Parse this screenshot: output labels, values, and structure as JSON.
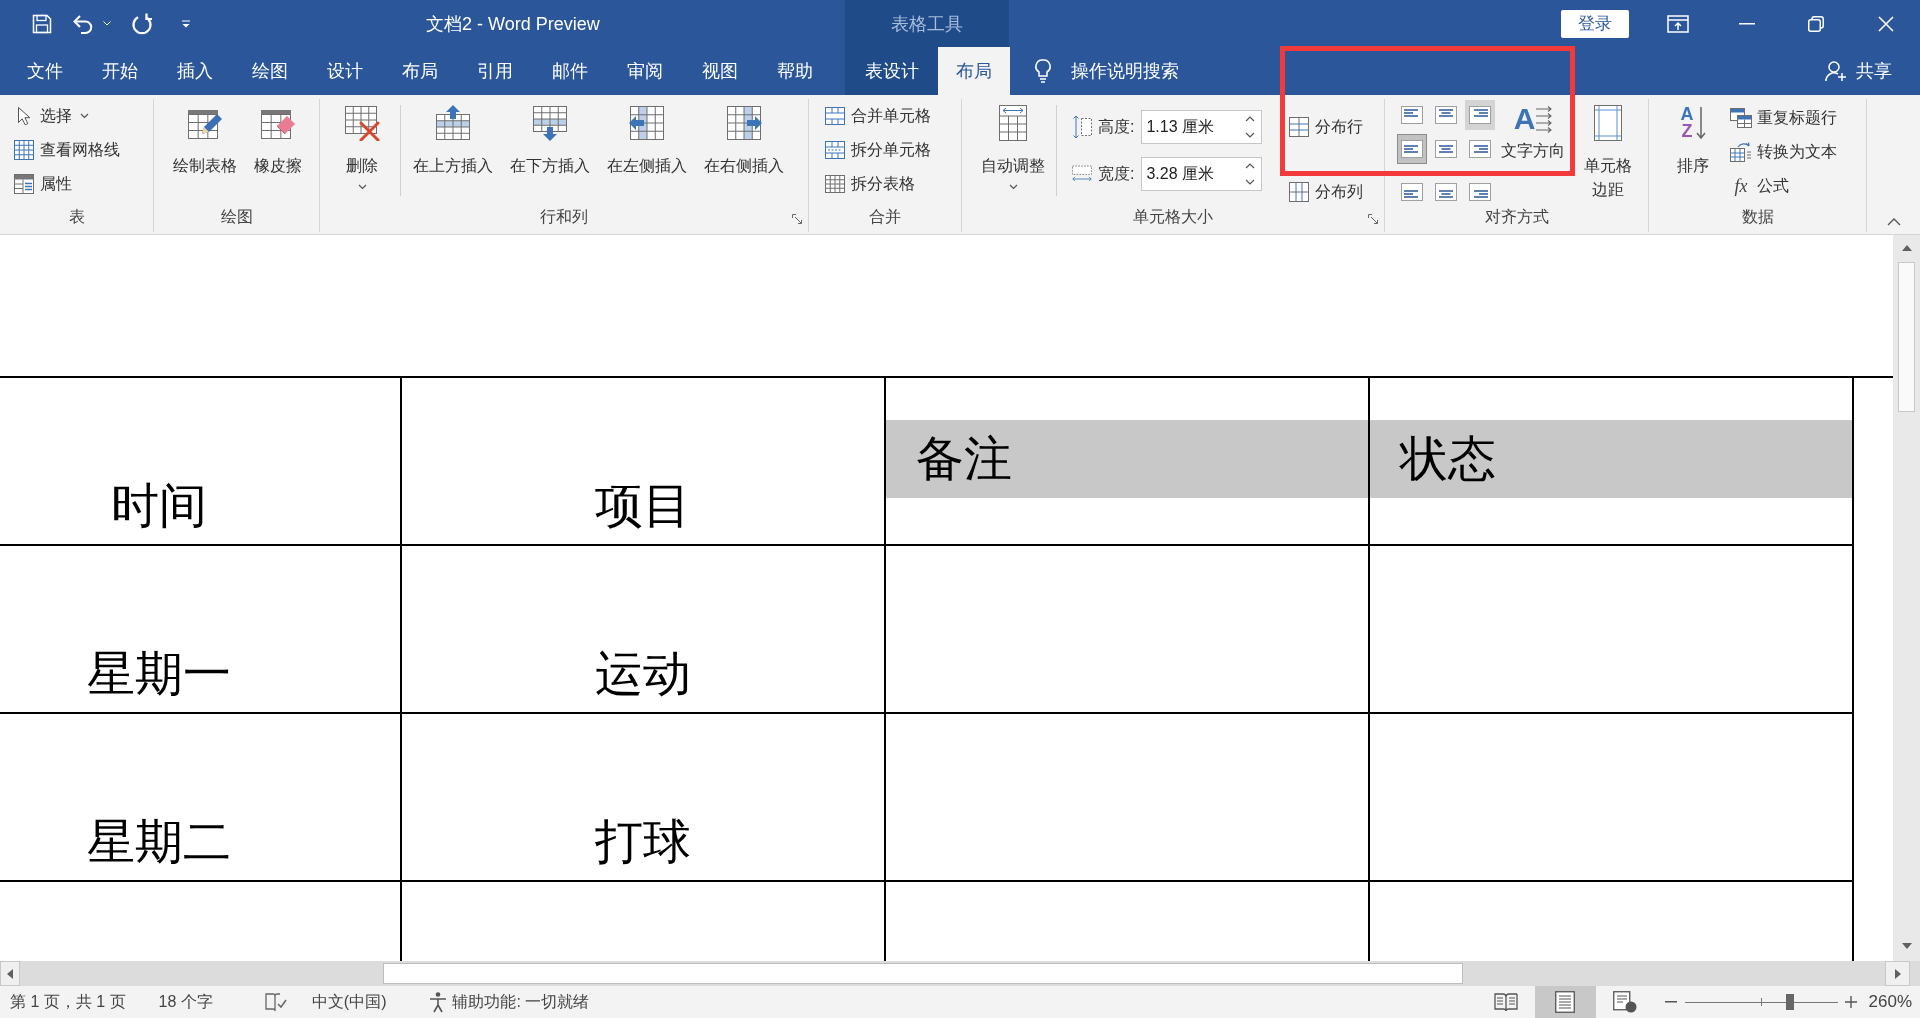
{
  "title_bar": {
    "title": "文档2 - Word Preview",
    "login_button": "登录"
  },
  "tabs": [
    {
      "label": "文件",
      "selected": false
    },
    {
      "label": "开始",
      "selected": false
    },
    {
      "label": "插入",
      "selected": false
    },
    {
      "label": "绘图",
      "selected": false
    },
    {
      "label": "设计",
      "selected": false
    },
    {
      "label": "布局",
      "selected": false
    },
    {
      "label": "引用",
      "selected": false
    },
    {
      "label": "邮件",
      "selected": false
    },
    {
      "label": "审阅",
      "selected": false
    },
    {
      "label": "视图",
      "selected": false
    },
    {
      "label": "帮助",
      "selected": false
    }
  ],
  "contextual_tabs": {
    "title": "表格工具",
    "tabs": [
      {
        "label": "表设计",
        "selected": false
      },
      {
        "label": "布局",
        "selected": true
      }
    ]
  },
  "tell_me": {
    "label": "操作说明搜索"
  },
  "share": {
    "label": "共享"
  },
  "ribbon": {
    "groups": [
      {
        "label": "表",
        "dialog_launcher": false,
        "sections": [
          {
            "kind": "small",
            "items": [
              {
                "label": "选择",
                "dropdown": true
              },
              {
                "label": "查看网格线",
                "dropdown": false
              },
              {
                "label": "属性",
                "dropdown": false
              }
            ]
          }
        ]
      },
      {
        "label": "绘图",
        "dialog_launcher": false,
        "sections": [
          {
            "kind": "large",
            "items": [
              {
                "label": "绘制表格",
                "dropdown": false
              },
              {
                "label": "橡皮擦",
                "dropdown": false
              }
            ]
          }
        ]
      },
      {
        "label": "行和列",
        "dialog_launcher": true,
        "sections": [
          {
            "kind": "large",
            "items": [
              {
                "label": "删除",
                "dropdown": true
              }
            ]
          },
          {
            "kind": "large",
            "items": [
              {
                "label": "在上方插入",
                "dropdown": false
              },
              {
                "label": "在下方插入",
                "dropdown": false
              },
              {
                "label": "在左侧插入",
                "dropdown": false
              },
              {
                "label": "在右侧插入",
                "dropdown": false
              }
            ]
          }
        ]
      },
      {
        "label": "合并",
        "dialog_launcher": false,
        "sections": [
          {
            "kind": "small",
            "items": [
              {
                "label": "合并单元格",
                "dropdown": false
              },
              {
                "label": "拆分单元格",
                "dropdown": false
              },
              {
                "label": "拆分表格",
                "dropdown": false
              }
            ]
          }
        ]
      },
      {
        "label": "单元格大小",
        "dialog_launcher": true,
        "sections": [
          {
            "kind": "large",
            "items": [
              {
                "label": "自动调整",
                "dropdown": true
              }
            ]
          },
          {
            "kind": "spinners",
            "items": [
              {
                "label": "高度:",
                "value": "1.13 厘米"
              },
              {
                "label": "宽度:",
                "value": "3.28 厘米"
              }
            ]
          },
          {
            "kind": "small",
            "items": [
              {
                "label": "分布行",
                "dropdown": false
              },
              {
                "label": "分布列",
                "dropdown": false
              }
            ]
          }
        ]
      },
      {
        "label": "对齐方式",
        "dialog_launcher": false,
        "sections": [
          {
            "kind": "align_grid",
            "items": [
              {
                "selected": false,
                "hovered": false
              },
              {
                "selected": false,
                "hovered": false
              },
              {
                "selected": false,
                "hovered": true
              },
              {
                "selected": true,
                "hovered": false
              },
              {
                "selected": false,
                "hovered": false
              },
              {
                "selected": false,
                "hovered": false
              },
              {
                "selected": false,
                "hovered": false
              },
              {
                "selected": false,
                "hovered": false
              },
              {
                "selected": false,
                "hovered": false
              }
            ]
          },
          {
            "kind": "large",
            "items": [
              {
                "label": "文字方向",
                "dropdown": false,
                "glyphs": [
                  "A"
                ]
              },
              {
                "label": "单元格边距",
                "dropdown": false
              }
            ]
          }
        ]
      },
      {
        "label": "数据",
        "dialog_launcher": false,
        "sections": [
          {
            "kind": "large",
            "items": [
              {
                "label": "排序",
                "dropdown": false,
                "glyphs": [
                  "A",
                  "Z"
                ]
              }
            ]
          },
          {
            "kind": "small",
            "items": [
              {
                "label": "重复标题行",
                "dropdown": false
              },
              {
                "label": "转换为文本",
                "dropdown": false
              },
              {
                "label": "公式",
                "dropdown": false,
                "glyphs": [
                  "fx"
                ]
              }
            ]
          }
        ]
      }
    ]
  },
  "document": {
    "table": {
      "rows": [
        {
          "cells": [
            {
              "text": "时间",
              "selected": false,
              "top_aligned": false
            },
            {
              "text": "项目",
              "selected": false,
              "top_aligned": false
            },
            {
              "text": "备注",
              "selected": true,
              "top_aligned": true
            },
            {
              "text": "状态",
              "selected": true,
              "top_aligned": true
            }
          ]
        },
        {
          "cells": [
            {
              "text": "星期一",
              "selected": false,
              "top_aligned": false
            },
            {
              "text": "运动",
              "selected": false,
              "top_aligned": false
            }
          ]
        },
        {
          "cells": [
            {
              "text": "星期二",
              "selected": false,
              "top_aligned": false
            },
            {
              "text": "打球",
              "selected": false,
              "top_aligned": false
            }
          ]
        }
      ]
    }
  },
  "status_bar": {
    "page": "第 1 页，共 1 页",
    "word_count": "18 个字",
    "language": "中文(中国)",
    "accessibility": "辅助功能: 一切就绪",
    "views": [
      {
        "selected": false
      },
      {
        "selected": true
      },
      {
        "selected": false
      }
    ],
    "zoom": {
      "level": 0.69,
      "reading": "260%"
    }
  }
}
